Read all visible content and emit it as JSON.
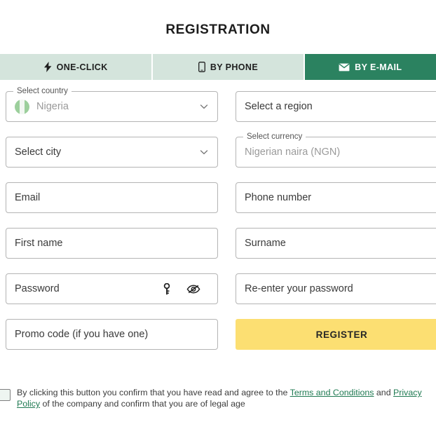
{
  "header": {
    "title": "REGISTRATION"
  },
  "tabs": [
    {
      "id": "one-click",
      "label": "ONE-CLICK",
      "icon": "lightning-bolt-icon",
      "active": false
    },
    {
      "id": "by-phone",
      "label": "BY PHONE",
      "icon": "smartphone-icon",
      "active": false
    },
    {
      "id": "by-email",
      "label": "BY E-MAIL",
      "icon": "envelope-icon",
      "active": true
    }
  ],
  "form": {
    "country": {
      "label": "Select country",
      "value": "Nigeria",
      "flag_icon": "nigeria-flag-icon",
      "chevron_icon": "chevron-down-icon"
    },
    "region": {
      "placeholder": "Select a region"
    },
    "city": {
      "placeholder": "Select city",
      "chevron_icon": "chevron-down-icon"
    },
    "currency": {
      "label": "Select currency",
      "value": "Nigerian naira (NGN)"
    },
    "email": {
      "placeholder": "Email"
    },
    "phone": {
      "placeholder": "Phone number"
    },
    "first_name": {
      "placeholder": "First name"
    },
    "surname": {
      "placeholder": "Surname"
    },
    "password": {
      "placeholder": "Password",
      "key_icon": "key-icon",
      "visibility_icon": "eye-off-icon"
    },
    "confirm_password": {
      "placeholder": "Re-enter your password"
    },
    "promo_code": {
      "placeholder": "Promo code (if you have one)"
    },
    "register_button": {
      "label": "REGISTER"
    }
  },
  "consent": {
    "text_before": "By clicking this button you confirm that you have read and agree to the ",
    "terms_link": "Terms and Conditions",
    "text_between": " and ",
    "privacy_link": "Privacy Policy",
    "text_after": " of the company and confirm that you are of legal age"
  },
  "colors": {
    "tab_inactive_bg": "#d4e4dc",
    "tab_active_bg": "#2b8260",
    "register_button_bg": "#fcdf72",
    "link_green": "#1f7a52",
    "field_border": "#b4b4b4"
  }
}
